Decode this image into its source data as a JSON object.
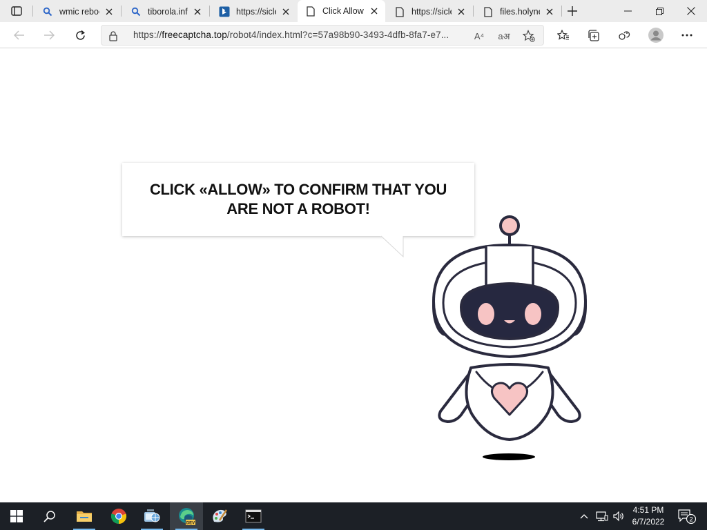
{
  "browser": {
    "tabs": [
      {
        "title": "wmic reboot",
        "icon": "search-icon"
      },
      {
        "title": "tiborola.info",
        "icon": "search-icon"
      },
      {
        "title": "https://sicle",
        "icon": "bing-icon"
      },
      {
        "title": "Click Allow",
        "icon": "page-icon",
        "active": true
      },
      {
        "title": "https://sicle",
        "icon": "page-icon"
      },
      {
        "title": "files.holyne",
        "icon": "page-icon"
      }
    ],
    "address": {
      "scheme": "https://",
      "host": "freecaptcha.top",
      "path": "/robot4/index.html?c=57a98b90-3493-4dfb-8fa7-e7..."
    },
    "read_aloud_label": "A⁴",
    "translate_label": "aअ"
  },
  "page": {
    "message": "CLICK «ALLOW» TO CONFIRM THAT YOU ARE NOT A ROBOT!"
  },
  "taskbar": {
    "apps": [
      "file-explorer-icon",
      "chrome-icon",
      "network-app-icon",
      "edge-dev-icon",
      "paint-icon",
      "terminal-icon"
    ],
    "clock_time": "4:51 PM",
    "clock_date": "6/7/2022",
    "notification_count": "2"
  },
  "colors": {
    "robot_outline": "#2a2a3e",
    "robot_pink": "#f7c4c4",
    "robot_visor": "#262840",
    "taskbar": "#1c2026"
  }
}
